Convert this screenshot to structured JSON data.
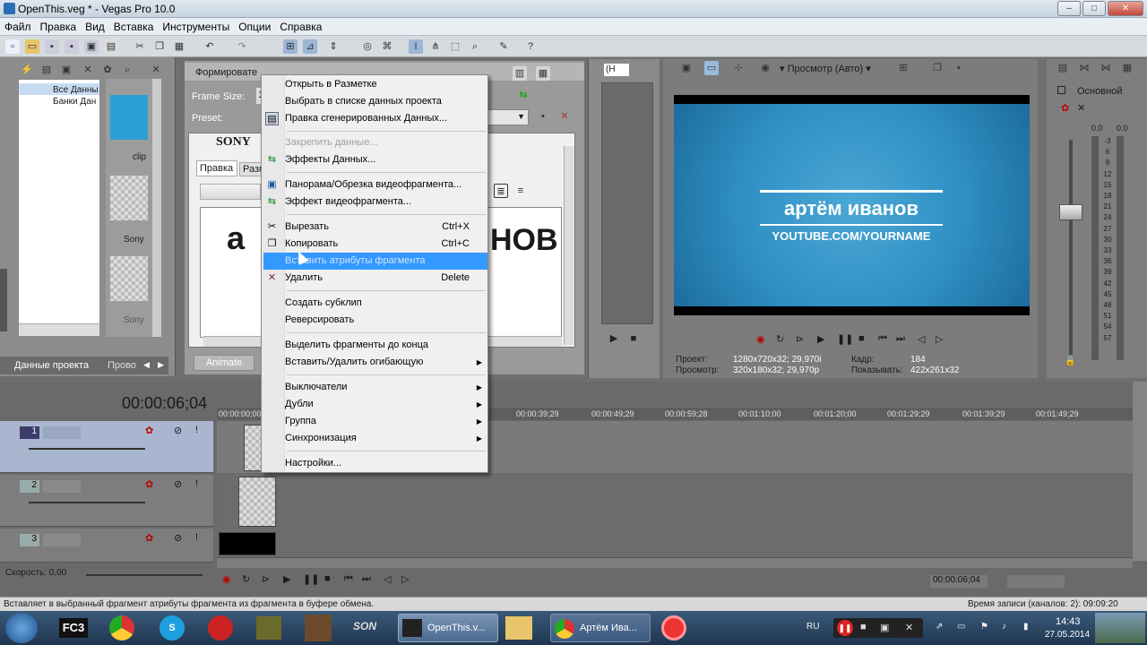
{
  "window": {
    "title": "OpenThis.veg * - Vegas Pro 10.0",
    "min_glyph": "–",
    "max_glyph": "□",
    "close_glyph": "✕"
  },
  "menu": [
    "Файл",
    "Правка",
    "Вид",
    "Вставка",
    "Инструменты",
    "Опции",
    "Справка"
  ],
  "explorer": {
    "tree_items": [
      "Все Данны",
      "Банки Дан"
    ],
    "thumb_labels": [
      "clip",
      "Sony",
      "Sony"
    ],
    "tabs": [
      "Данные проекта",
      "Прово"
    ]
  },
  "generator": {
    "header": "Формировате",
    "frame_size_label": "Frame Size:",
    "frame_size_value": "1",
    "preset_label": "Preset:",
    "sony_text": "SONY",
    "tab_edit": "Правка",
    "tab_size": "Разм",
    "big_text": "НОВ",
    "big_text_left": "а",
    "animate_button": "Animate"
  },
  "context_menu": {
    "items": [
      {
        "label": "Открыть в Разметке",
        "shortcut": "",
        "disabled": false,
        "submenu": false,
        "icon": ""
      },
      {
        "label": "Выбрать в списке данных проекта",
        "shortcut": "",
        "disabled": false,
        "submenu": false,
        "icon": ""
      },
      {
        "label": "Правка сгенерированных Данных...",
        "shortcut": "",
        "disabled": false,
        "submenu": false,
        "icon": "generated-media-icon"
      },
      {
        "label": "Закрепить данные...",
        "shortcut": "",
        "disabled": true,
        "submenu": false,
        "icon": ""
      },
      {
        "label": "Эффекты Данных...",
        "shortcut": "",
        "disabled": false,
        "submenu": false,
        "icon": "media-fx-icon"
      },
      {
        "label": "Панорама/Обрезка видеофрагмента...",
        "shortcut": "",
        "disabled": false,
        "submenu": false,
        "icon": "pan-crop-icon"
      },
      {
        "label": "Эффект видеофрагмента...",
        "shortcut": "",
        "disabled": false,
        "submenu": false,
        "icon": "event-fx-icon"
      },
      {
        "label": "Вырезать",
        "shortcut": "Ctrl+X",
        "disabled": false,
        "submenu": false,
        "icon": "scissors-icon"
      },
      {
        "label": "Копировать",
        "shortcut": "Ctrl+C",
        "disabled": false,
        "submenu": false,
        "icon": "copy-icon"
      },
      {
        "label": "Вставить атрибуты фрагмента",
        "shortcut": "",
        "disabled": false,
        "submenu": false,
        "icon": "",
        "highlighted": true
      },
      {
        "label": "Удалить",
        "shortcut": "Delete",
        "disabled": false,
        "submenu": false,
        "icon": "delete-icon"
      },
      {
        "label": "Создать субклип",
        "shortcut": "",
        "disabled": false,
        "submenu": false,
        "icon": ""
      },
      {
        "label": "Реверсировать",
        "shortcut": "",
        "disabled": false,
        "submenu": false,
        "icon": ""
      },
      {
        "label": "Выделить фрагменты до конца",
        "shortcut": "",
        "disabled": false,
        "submenu": false,
        "icon": ""
      },
      {
        "label": "Вставить/Удалить огибающую",
        "shortcut": "",
        "disabled": false,
        "submenu": true,
        "icon": ""
      },
      {
        "label": "Выключатели",
        "shortcut": "",
        "disabled": false,
        "submenu": true,
        "icon": ""
      },
      {
        "label": "Дубли",
        "shortcut": "",
        "disabled": false,
        "submenu": true,
        "icon": ""
      },
      {
        "label": "Группа",
        "shortcut": "",
        "disabled": false,
        "submenu": true,
        "icon": ""
      },
      {
        "label": "Синхронизация",
        "shortcut": "",
        "disabled": false,
        "submenu": true,
        "icon": ""
      },
      {
        "label": "Настройки...",
        "shortcut": "",
        "disabled": false,
        "submenu": false,
        "icon": ""
      }
    ]
  },
  "preview": {
    "mode_label": "Просмотр (Авто)",
    "track_select": "(H",
    "video_title": "артём иванов",
    "video_subtitle": "YOUTUBE.COM/YOURNAME",
    "project_label": "Проект:",
    "project_value": "1280x720x32; 29,970i",
    "preview_label": "Просмотр:",
    "preview_value": "320x180x32; 29,970p",
    "frame_label": "Кадр:",
    "frame_value": "184",
    "display_label": "Показывать:",
    "display_value": "422x261x32"
  },
  "mixer": {
    "title": "Основной",
    "scale": [
      "-3",
      "6",
      "9",
      "12",
      "15",
      "18",
      "21",
      "24",
      "27",
      "30",
      "33",
      "36",
      "39",
      "42",
      "45",
      "48",
      "51",
      "54",
      "57"
    ],
    "peak_left": "0.0",
    "peak_right": "0.0"
  },
  "timeline": {
    "timecode": "00:00:06;04",
    "ruler": [
      "00:00:00;00",
      "00:00:39;29",
      "00:00:49;29",
      "00:00:59;28",
      "00:01:10;00",
      "00:01:20;00",
      "00:01:29;29",
      "00:01:39;29",
      "00:01:49;29"
    ],
    "tracks": [
      "1",
      "2",
      "3"
    ],
    "speed_label": "Скорость: 0,00",
    "cursor_time": "00:00:06;04"
  },
  "status": {
    "left": "Вставляет в выбранный фрагмент атрибуты фрагмента из фрагмента в буфере обмена.",
    "right": "Время записи (каналов: 2): 09:09:20"
  },
  "taskbar": {
    "tasks": [
      "OpenThis.v...",
      "Артём Ива..."
    ],
    "lang": "RU",
    "time": "14:43",
    "date": "27.05.2014",
    "fc3": "FC3"
  }
}
